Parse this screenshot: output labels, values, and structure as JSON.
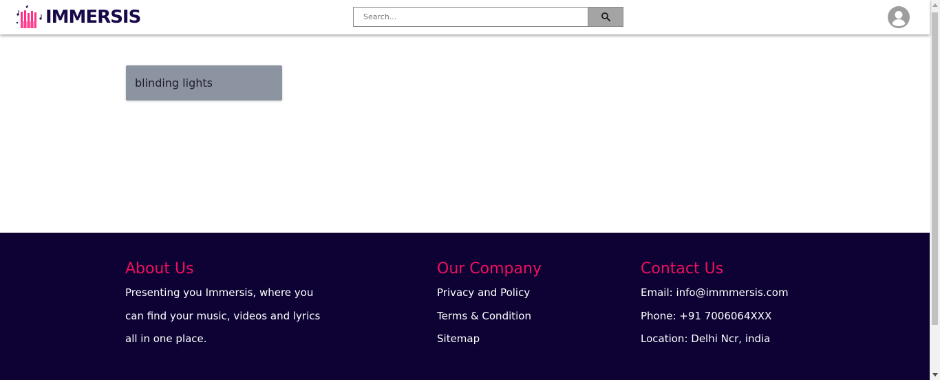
{
  "header": {
    "logo_text": "IMMERSIS",
    "search": {
      "placeholder": "Search...",
      "value": ""
    }
  },
  "results": [
    {
      "title": "blinding lights"
    }
  ],
  "footer": {
    "about": {
      "heading": "About Us",
      "lines": [
        "Presenting you Immersis, where you",
        "can find your music, videos and lyrics",
        "all in one place."
      ]
    },
    "company": {
      "heading": "Our Company",
      "links": [
        "Privacy and Policy",
        "Terms & Condition",
        "Sitemap"
      ]
    },
    "contact": {
      "heading": "Contact Us",
      "email": "Email: info@immmersis.com",
      "phone": "Phone: +91 7006064XXX",
      "location": "Location: Delhi Ncr, india"
    }
  },
  "colors": {
    "accent": "#ee0f5f",
    "footer_bg": "#0d0233",
    "logo_text": "#1a0a4a",
    "card_bg": "#8c93a1"
  },
  "icons": [
    "logo-icon",
    "search-icon",
    "user-avatar-icon"
  ]
}
